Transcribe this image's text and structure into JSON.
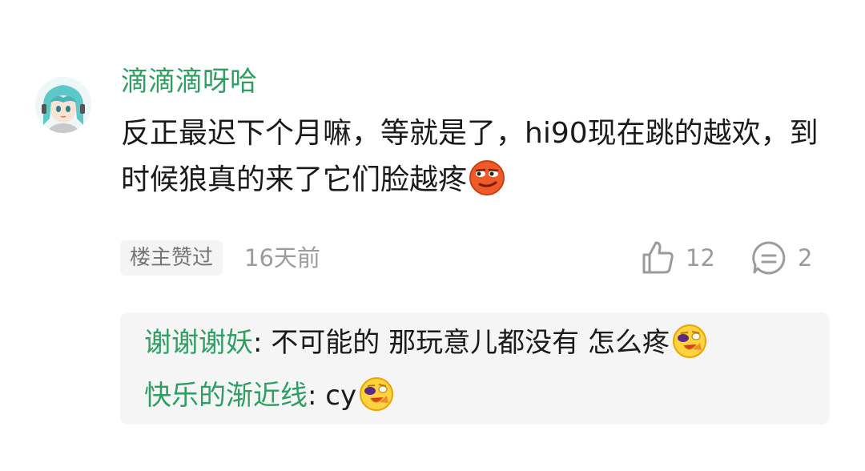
{
  "comment": {
    "username": "滴滴滴呀哈",
    "text": "反正最迟下个月嘛，等就是了，hi90现在跳的越欢，到时候狼真的来了它们脸越疼",
    "text_emoji": "smirk-face-emoji",
    "op_badge": "楼主赞过",
    "time": "16天前",
    "likes": "12",
    "reply_count": "2",
    "colors": {
      "username": "#2f9e63",
      "meta": "#9b9b9b",
      "reply_bg": "#f5f5f5"
    }
  },
  "replies": [
    {
      "name": "谢谢谢妖",
      "separator": ": ",
      "text": "不可能的 那玩意儿都没有 怎么疼",
      "emoji": "grin-face-emoji"
    },
    {
      "name": "快乐的渐近线",
      "separator": ": ",
      "text": "cy",
      "emoji": "grin-face-emoji"
    }
  ]
}
